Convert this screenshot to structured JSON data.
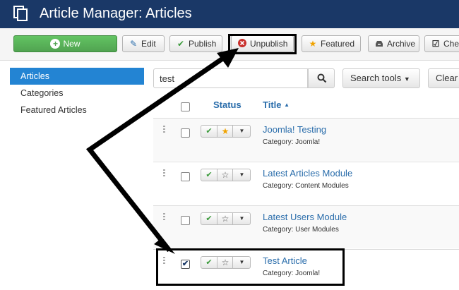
{
  "header": {
    "title": "Article Manager: Articles"
  },
  "toolbar": {
    "new_label": "New",
    "edit_label": "Edit",
    "publish_label": "Publish",
    "unpublish_label": "Unpublish",
    "featured_label": "Featured",
    "archive_label": "Archive",
    "checkin_label": "Che"
  },
  "sidebar": {
    "items": [
      {
        "label": "Articles"
      },
      {
        "label": "Categories"
      },
      {
        "label": "Featured Articles"
      }
    ]
  },
  "search": {
    "value": "test",
    "tools_label": "Search tools",
    "clear_label": "Clear"
  },
  "table": {
    "status_header": "Status",
    "title_header": "Title",
    "rows": [
      {
        "title": "Joomla! Testing",
        "category": "Category: Joomla!",
        "checked": false,
        "featured": true
      },
      {
        "title": "Latest Articles Module",
        "category": "Category: Content Modules",
        "checked": false,
        "featured": false
      },
      {
        "title": "Latest Users Module",
        "category": "Category: User Modules",
        "checked": false,
        "featured": false
      },
      {
        "title": "Test Article",
        "category": "Category: Joomla!",
        "checked": true,
        "featured": false
      }
    ]
  },
  "colors": {
    "header_bg": "#1a3867",
    "new_button": "#51a351",
    "sidebar_active": "#2384d3",
    "link": "#2a6dab",
    "check_green": "#3a9a3a",
    "featured_star": "#f0a300",
    "unpublish_icon": "#c9302c"
  },
  "icons": [
    "articles-icon",
    "plus-circle-icon",
    "edit-icon",
    "check-icon",
    "x-circle-icon",
    "star-icon",
    "archive-icon",
    "checkbox-icon",
    "search-icon",
    "caret-down-icon",
    "sort-up-icon",
    "drag-handle-icon"
  ]
}
